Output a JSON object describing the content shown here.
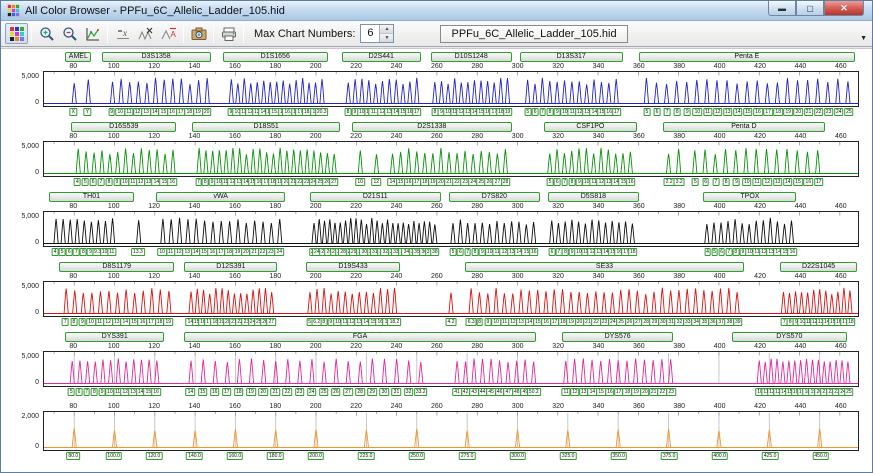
{
  "window": {
    "title": "All Color Browser - PPFu_6C_Allelic_Ladder_105.hid"
  },
  "toolbar": {
    "max_chart_label": "Max Chart Numbers:",
    "max_chart_value": "6",
    "tab_label": "PPFu_6C_Allelic_Ladder_105.hid",
    "icons": [
      "all-color-grid",
      "zoom-in",
      "zoom-out",
      "scale-chart",
      "hide-baseline",
      "peaks-x",
      "peaks-a",
      "camera",
      "printer"
    ]
  },
  "plot": {
    "bp_min": 65,
    "bp_max": 469,
    "ticks": [
      80,
      100,
      120,
      140,
      160,
      180,
      200,
      220,
      240,
      260,
      280,
      300,
      320,
      340,
      360,
      380,
      400,
      420,
      440,
      460
    ],
    "size_positions": [
      80,
      100,
      120,
      140,
      160,
      180,
      200,
      225,
      250,
      275,
      300,
      325,
      350,
      375,
      400,
      425,
      450
    ]
  },
  "panels": [
    {
      "dye": "blue",
      "color": "#2222cc",
      "y_max": "5,000",
      "y_min": "0",
      "h_base": 0.68,
      "h_amp": 0.24,
      "markers": [
        {
          "label": "AMEL",
          "start": 76,
          "end": 89
        },
        {
          "label": "D3S1358",
          "start": 94,
          "end": 148
        },
        {
          "label": "D1S1656",
          "start": 154,
          "end": 206
        },
        {
          "label": "D2S441",
          "start": 213,
          "end": 252
        },
        {
          "label": "D10S1248",
          "start": 257,
          "end": 297
        },
        {
          "label": "D13S317",
          "start": 301,
          "end": 352
        },
        {
          "label": "Penta E",
          "start": 360,
          "end": 467
        }
      ],
      "groups": [
        {
          "labels": [
            "X",
            "Y"
          ],
          "start": 80,
          "end": 87
        },
        {
          "labels": [
            "9",
            "10",
            "11",
            "12",
            "13",
            "14",
            "15",
            "16",
            "17",
            "18",
            "19",
            "20"
          ],
          "start": 99,
          "end": 146
        },
        {
          "labels": [
            "9",
            "10",
            "11",
            "12",
            "13",
            "14",
            "15",
            "15.3",
            "16",
            "16.3",
            "17",
            "17.3",
            "18.3",
            "19",
            "20.3"
          ],
          "start": 158,
          "end": 203
        },
        {
          "labels": [
            "8",
            "9",
            "10",
            "11",
            "11.3",
            "12",
            "13",
            "14",
            "15",
            "16",
            "17"
          ],
          "start": 216,
          "end": 250
        },
        {
          "labels": [
            "8",
            "9",
            "10",
            "11",
            "12",
            "13",
            "14",
            "15",
            "16",
            "17",
            "18",
            "19"
          ],
          "start": 259,
          "end": 295
        },
        {
          "labels": [
            "5",
            "6",
            "7",
            "8",
            "9",
            "10",
            "11",
            "12",
            "13",
            "14",
            "15",
            "16",
            "17"
          ],
          "start": 305,
          "end": 349
        },
        {
          "labels": [
            "5",
            "6",
            "7",
            "8",
            "9",
            "10",
            "11",
            "12",
            "13",
            "14",
            "15",
            "16",
            "17",
            "18",
            "19",
            "20",
            "21",
            "22",
            "23",
            "24",
            "25"
          ],
          "start": 364,
          "end": 464
        }
      ]
    },
    {
      "dye": "green",
      "color": "#079407",
      "y_max": "5,000",
      "y_min": "0",
      "h_base": 0.68,
      "h_amp": 0.24,
      "markers": [
        {
          "label": "D16S539",
          "start": 79,
          "end": 131
        },
        {
          "label": "D18S51",
          "start": 139,
          "end": 212
        },
        {
          "label": "D2S1338",
          "start": 218,
          "end": 297
        },
        {
          "label": "CSF1PO",
          "start": 313,
          "end": 359
        },
        {
          "label": "Penta D",
          "start": 372,
          "end": 452
        }
      ],
      "groups": [
        {
          "labels": [
            "4",
            "5",
            "6",
            "7",
            "8",
            "9",
            "10",
            "11",
            "12",
            "13",
            "14",
            "15",
            "16"
          ],
          "start": 82,
          "end": 129
        },
        {
          "labels": [
            "7",
            "8",
            "9",
            "10",
            "11",
            "12",
            "13",
            "14",
            "15",
            "16",
            "17",
            "18",
            "19",
            "20",
            "21",
            "22",
            "23",
            "24",
            "25",
            "26",
            "27"
          ],
          "start": 142,
          "end": 209
        },
        {
          "labels": [
            "10"
          ],
          "start": 222,
          "end": 222
        },
        {
          "labels": [
            "12"
          ],
          "start": 230,
          "end": 230
        },
        {
          "labels": [
            "14",
            "15",
            "16",
            "17",
            "18",
            "19",
            "20",
            "21",
            "22",
            "23",
            "24",
            "25",
            "26",
            "27",
            "28"
          ],
          "start": 238,
          "end": 294
        },
        {
          "labels": [
            "5",
            "6",
            "7",
            "8",
            "9",
            "10",
            "11",
            "12",
            "13",
            "14",
            "15",
            "16"
          ],
          "start": 316,
          "end": 356
        },
        {
          "labels": [
            "2.2",
            "3.2"
          ],
          "start": 375,
          "end": 380
        },
        {
          "labels": [
            "5",
            "6",
            "7",
            "8",
            "9",
            "10",
            "11",
            "12",
            "13",
            "14",
            "15",
            "16",
            "17"
          ],
          "start": 388,
          "end": 449
        }
      ]
    },
    {
      "dye": "black",
      "color": "#0d0d0d",
      "y_max": "5,000",
      "y_min": "0",
      "h_base": 0.68,
      "h_amp": 0.24,
      "markers": [
        {
          "label": "TH01",
          "start": 68,
          "end": 110
        },
        {
          "label": "vWA",
          "start": 121,
          "end": 185
        },
        {
          "label": "D21S11",
          "start": 197,
          "end": 262
        },
        {
          "label": "D7S820",
          "start": 266,
          "end": 311
        },
        {
          "label": "D5S818",
          "start": 315,
          "end": 360
        },
        {
          "label": "TPOX",
          "start": 392,
          "end": 438
        }
      ],
      "groups": [
        {
          "labels": [
            "4",
            "5",
            "6",
            "7",
            "8",
            "9",
            "9.3",
            "10",
            "11"
          ],
          "start": 71,
          "end": 99
        },
        {
          "labels": [
            "13.3"
          ],
          "start": 112,
          "end": 112
        },
        {
          "labels": [
            "10",
            "11",
            "12",
            "13",
            "14",
            "15",
            "16",
            "17",
            "18",
            "19",
            "20",
            "21",
            "22",
            "23",
            "24"
          ],
          "start": 124,
          "end": 182
        },
        {
          "labels": [
            "24",
            "24.2",
            "25",
            "26",
            "27",
            "28",
            "28.2",
            "29",
            "29.2",
            "30",
            "30.2",
            "31",
            "31.2",
            "32",
            "32.2",
            "33",
            "33.2",
            "34",
            "34.2",
            "35",
            "35.2",
            "36",
            "37",
            "38"
          ],
          "start": 199,
          "end": 259
        },
        {
          "labels": [
            "5",
            "6",
            "7",
            "8",
            "9",
            "10",
            "11",
            "12",
            "13",
            "14",
            "15",
            "16"
          ],
          "start": 268,
          "end": 308
        },
        {
          "labels": [
            "6",
            "7",
            "8",
            "9",
            "10",
            "11",
            "12",
            "13",
            "14",
            "15",
            "16",
            "17",
            "18"
          ],
          "start": 317,
          "end": 357
        },
        {
          "labels": [
            "4",
            "5",
            "6",
            "7",
            "8",
            "9",
            "10",
            "11",
            "12",
            "13",
            "14",
            "15",
            "16"
          ],
          "start": 394,
          "end": 436
        }
      ]
    },
    {
      "dye": "red",
      "color": "#dd1111",
      "y_max": "5,000",
      "y_min": "0",
      "h_base": 0.68,
      "h_amp": 0.24,
      "markers": [
        {
          "label": "D8S1179",
          "start": 73,
          "end": 130
        },
        {
          "label": "D12S391",
          "start": 135,
          "end": 181
        },
        {
          "label": "D19S433",
          "start": 195,
          "end": 242
        },
        {
          "label": "SE33",
          "start": 274,
          "end": 412
        },
        {
          "label": "D22S1045",
          "start": 430,
          "end": 468
        }
      ],
      "groups": [
        {
          "labels": [
            "7",
            "8",
            "9",
            "10",
            "11",
            "12",
            "13",
            "14",
            "15",
            "16",
            "17",
            "18",
            "19"
          ],
          "start": 76,
          "end": 127
        },
        {
          "labels": [
            "14",
            "15",
            "16",
            "17",
            "18",
            "19",
            "20",
            "21",
            "22",
            "23",
            "24",
            "25",
            "26",
            "27"
          ],
          "start": 138,
          "end": 178
        },
        {
          "labels": [
            "5",
            "6.2",
            "8",
            "9",
            "10",
            "11",
            "12",
            "13",
            "14",
            "15",
            "16",
            "17",
            "18.2"
          ],
          "start": 197,
          "end": 239
        },
        {
          "labels": [
            "4.2"
          ],
          "start": 267,
          "end": 267
        },
        {
          "labels": [
            "6.3",
            "8",
            "9",
            "10",
            "11",
            "12",
            "13",
            "14",
            "15",
            "16",
            "17",
            "18",
            "19",
            "20",
            "21",
            "22",
            "23",
            "24",
            "25",
            "26",
            "27",
            "28",
            "29",
            "30",
            "31",
            "32",
            "33",
            "34",
            "35",
            "36",
            "37",
            "38",
            "39"
          ],
          "start": 277,
          "end": 409
        },
        {
          "labels": [
            "7",
            "8",
            "9",
            "10",
            "11",
            "12",
            "13",
            "14",
            "15",
            "16",
            "17",
            "18"
          ],
          "start": 432,
          "end": 465
        }
      ]
    },
    {
      "dye": "magenta",
      "color": "#e3289b",
      "y_max": "5,000",
      "y_min": "0",
      "h_base": 0.76,
      "h_amp": 0.14,
      "gridlines": true,
      "markers": [
        {
          "label": "DYS391",
          "start": 76,
          "end": 125
        },
        {
          "label": "FGA",
          "start": 135,
          "end": 309
        },
        {
          "label": "DYS576",
          "start": 322,
          "end": 377
        },
        {
          "label": "DYS570",
          "start": 406,
          "end": 463
        }
      ],
      "groups": [
        {
          "labels": [
            "5",
            "6",
            "7",
            "8",
            "9",
            "10",
            "11",
            "12",
            "13",
            "14",
            "15",
            "16"
          ],
          "start": 79,
          "end": 121
        },
        {
          "labels": [
            "14",
            "15",
            "16",
            "17",
            "18",
            "19",
            "20",
            "21",
            "22",
            "23",
            "24",
            "25",
            "26",
            "27",
            "28",
            "29",
            "30",
            "31",
            "32",
            "33.2"
          ],
          "start": 138,
          "end": 252
        },
        {
          "labels": [
            "41",
            "42",
            "43",
            "44",
            "45",
            "46",
            "47",
            "48",
            "49",
            "50.2"
          ],
          "start": 270,
          "end": 308
        },
        {
          "labels": [
            "11",
            "12",
            "13",
            "14",
            "15",
            "16",
            "17",
            "18",
            "19",
            "20",
            "21",
            "22",
            "23"
          ],
          "start": 324,
          "end": 376
        },
        {
          "labels": [
            "10",
            "11",
            "12",
            "13",
            "14",
            "15",
            "16",
            "17",
            "18",
            "19",
            "20",
            "21",
            "22",
            "23",
            "24",
            "25"
          ],
          "start": 420,
          "end": 464
        }
      ]
    },
    {
      "dye": "orange",
      "color": "#f59425",
      "y_max": "2,000",
      "y_min": "0",
      "h_base": 0.52,
      "h_amp": 0.08,
      "gridlines": true,
      "groups": [
        {
          "labels": [
            "80.0",
            "100.0",
            "120.0",
            "140.0",
            "160.0",
            "180.0",
            "200.0",
            "225.0",
            "250.0",
            "275.0",
            "300.0",
            "325.0",
            "350.0",
            "375.0",
            "400.0",
            "425.0",
            "450.0"
          ],
          "positions": [
            80,
            100,
            120,
            140,
            160,
            180,
            200,
            225,
            250,
            275,
            300,
            325,
            350,
            375,
            400,
            425,
            450
          ]
        }
      ]
    }
  ]
}
